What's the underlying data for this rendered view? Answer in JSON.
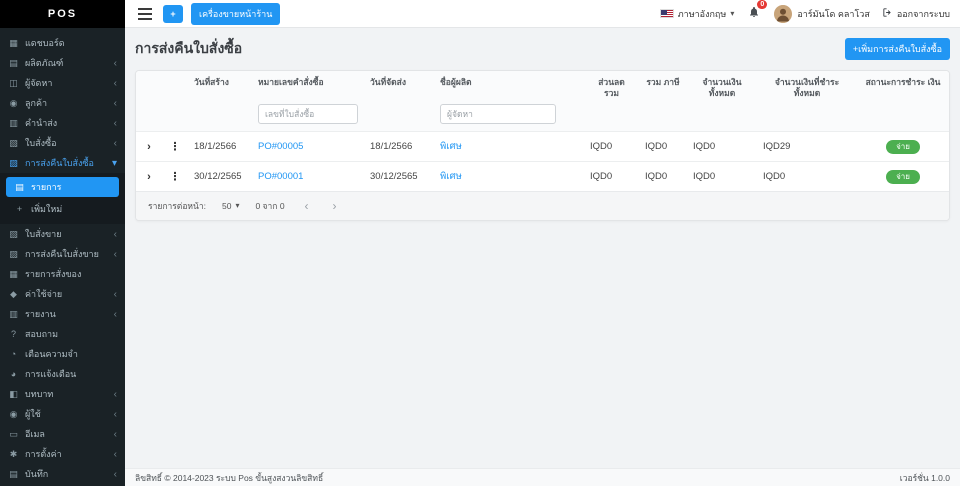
{
  "icons": {
    "dashboard": "▦",
    "products": "▤",
    "suppliers": "◫",
    "customers": "◉",
    "delivery": "▥",
    "purchase": "▧",
    "purchase_return": "▨",
    "list": "▤",
    "add": "+",
    "sale": "▧",
    "sale_return": "▨",
    "items": "▦",
    "expense": "◆",
    "report": "▥",
    "inquiry": "?",
    "reminder": "◔",
    "notification": "◕",
    "role": "◧",
    "user": "◉",
    "email": "▭",
    "settings": "✱",
    "log": "▤",
    "chevron_left": "‹",
    "chevron_down": "▾",
    "caret": "▾",
    "expand": "›",
    "dots": "⋮",
    "prev": "‹",
    "next": "›"
  },
  "brand": {
    "logo_text": "POS"
  },
  "navbar": {
    "plus": "+",
    "pos_button": "เครื่องขายหน้าร้าน",
    "language": "ภาษาอังกฤษ",
    "notification_count": "0",
    "user_name": "อาร์มันโด คลาโวส",
    "logout": "ออกจากระบบ"
  },
  "sidebar": {
    "items": [
      {
        "label": "แดชบอร์ด"
      },
      {
        "label": "ผลิตภัณฑ์"
      },
      {
        "label": "ผู้จัดหา"
      },
      {
        "label": "ลูกค้า"
      },
      {
        "label": "คำนำส่ง"
      },
      {
        "label": "ใบสั่งซื้อ"
      },
      {
        "label": "การส่งคืนใบสั่งซื้อ"
      },
      {
        "label": "ใบสั่งขาย"
      },
      {
        "label": "การส่งคืนใบสั่งขาย"
      },
      {
        "label": "รายการสั่งของ"
      },
      {
        "label": "ค่าใช้จ่าย"
      },
      {
        "label": "รายงาน"
      },
      {
        "label": "สอบถาม"
      },
      {
        "label": "เตือนความจำ"
      },
      {
        "label": "การแจ้งเตือน"
      },
      {
        "label": "บทบาท"
      },
      {
        "label": "ผู้ใช้"
      },
      {
        "label": "อีเมล"
      },
      {
        "label": "การตั้งค่า"
      },
      {
        "label": "บันทึก"
      }
    ],
    "submenu": [
      {
        "label": "รายการ"
      },
      {
        "label": "เพิ่มใหม่"
      }
    ]
  },
  "main": {
    "title": "การส่งคืนใบสั่งซื้อ",
    "add_button": "+เพิ่มการส่งคืนใบสั่งซื้อ",
    "table": {
      "columns": [
        "วันที่สร้าง",
        "หมายเลขคำสั่งซื้อ",
        "วันที่จัดส่ง",
        "ชื่อผู้ผลิต",
        "ส่วนลด รวม",
        "รวม ภาษี",
        "จำนวนเงิน ทั้งหมด",
        "จำนวนเงินที่ชำระ ทั้งหมด",
        "สถานะการชำระ เงิน"
      ],
      "filters": {
        "order_no": "เลขที่ใบสั่งซื้อ",
        "supplier": "ผู้จัดหา"
      },
      "rows": [
        {
          "created": "18/1/2566",
          "order_no": "PO#00005",
          "shipped": "18/1/2566",
          "supplier": "พิเศษ",
          "discount": "IQD0",
          "tax": "IQD0",
          "total": "IQD0",
          "paid": "IQD29",
          "status": "จ่าย"
        },
        {
          "created": "30/12/2565",
          "order_no": "PO#00001",
          "shipped": "30/12/2565",
          "supplier": "พิเศษ",
          "discount": "IQD0",
          "tax": "IQD0",
          "total": "IQD0",
          "paid": "IQD0",
          "status": "จ่าย"
        }
      ],
      "pagination": {
        "per_page_label": "รายการต่อหน้า:",
        "per_page": "50",
        "range": "0 จาก 0"
      }
    }
  },
  "footer": {
    "left": "ลิขสิทธิ์ © 2014-2023 ระบบ Pos ขั้นสูงสงวนลิขสิทธิ์",
    "right": "เวอร์ชั่น 1.0.0"
  }
}
